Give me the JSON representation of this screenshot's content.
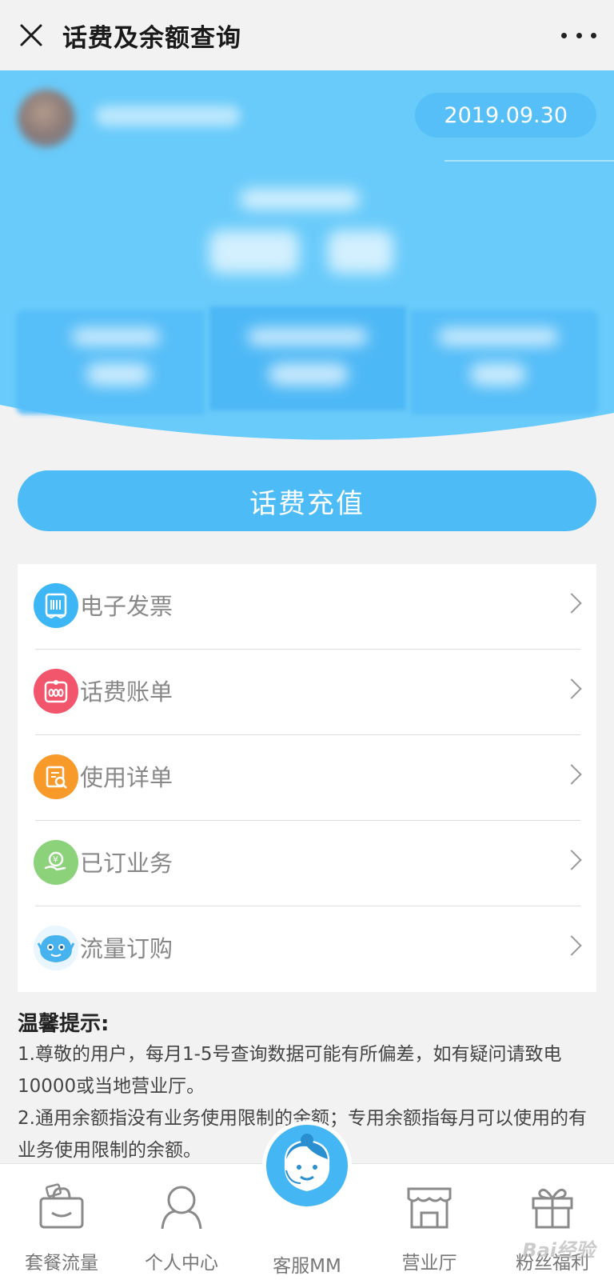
{
  "titlebar": {
    "title": "话费及余额查询",
    "close_icon": "close-icon",
    "more_icon": "more-dots-icon"
  },
  "header": {
    "date": "2019.09.30",
    "colors": {
      "accent": "#4dbbf6",
      "bg_light": "#6fcdfa"
    }
  },
  "actions": {
    "recharge_label": "话费充值"
  },
  "menu": {
    "items": [
      {
        "label": "电子发票",
        "icon": "invoice-icon",
        "color": "#3db6f5"
      },
      {
        "label": "话费账单",
        "icon": "bill-icon",
        "color": "#f2566c"
      },
      {
        "label": "使用详单",
        "icon": "usage-detail-icon",
        "color": "#f89a2a"
      },
      {
        "label": "已订业务",
        "icon": "subscribed-service-icon",
        "color": "#8bd27a"
      },
      {
        "label": "流量订购",
        "icon": "data-order-icon",
        "color": "#46b3ee"
      }
    ]
  },
  "tips": {
    "title": "温馨提示:",
    "lines": [
      "1.尊敬的用户，每月1-5号查询数据可能有所偏差，如有疑问请致电10000或当地营业厅。",
      "2.通用余额指没有业务使用限制的余额；专用余额指每月可以使用的有业务使用限制的余额。"
    ]
  },
  "bottom_nav": {
    "items": [
      {
        "label": "套餐流量",
        "icon": "package-icon"
      },
      {
        "label": "个人中心",
        "icon": "person-icon"
      },
      {
        "label": "客服MM",
        "icon": "customer-service-icon"
      },
      {
        "label": "营业厅",
        "icon": "store-icon"
      },
      {
        "label": "粉丝福利",
        "icon": "gift-icon"
      }
    ]
  },
  "watermark": "Bai经验"
}
